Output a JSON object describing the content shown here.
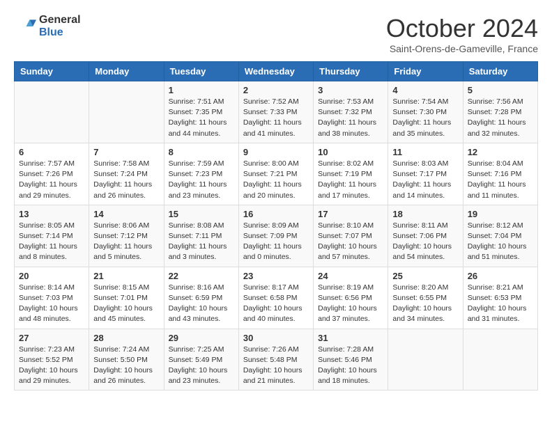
{
  "logo": {
    "general": "General",
    "blue": "Blue"
  },
  "header": {
    "month": "October 2024",
    "location": "Saint-Orens-de-Gameville, France"
  },
  "weekdays": [
    "Sunday",
    "Monday",
    "Tuesday",
    "Wednesday",
    "Thursday",
    "Friday",
    "Saturday"
  ],
  "weeks": [
    [
      {
        "day": "",
        "info": ""
      },
      {
        "day": "",
        "info": ""
      },
      {
        "day": "1",
        "info": "Sunrise: 7:51 AM\nSunset: 7:35 PM\nDaylight: 11 hours and 44 minutes."
      },
      {
        "day": "2",
        "info": "Sunrise: 7:52 AM\nSunset: 7:33 PM\nDaylight: 11 hours and 41 minutes."
      },
      {
        "day": "3",
        "info": "Sunrise: 7:53 AM\nSunset: 7:32 PM\nDaylight: 11 hours and 38 minutes."
      },
      {
        "day": "4",
        "info": "Sunrise: 7:54 AM\nSunset: 7:30 PM\nDaylight: 11 hours and 35 minutes."
      },
      {
        "day": "5",
        "info": "Sunrise: 7:56 AM\nSunset: 7:28 PM\nDaylight: 11 hours and 32 minutes."
      }
    ],
    [
      {
        "day": "6",
        "info": "Sunrise: 7:57 AM\nSunset: 7:26 PM\nDaylight: 11 hours and 29 minutes."
      },
      {
        "day": "7",
        "info": "Sunrise: 7:58 AM\nSunset: 7:24 PM\nDaylight: 11 hours and 26 minutes."
      },
      {
        "day": "8",
        "info": "Sunrise: 7:59 AM\nSunset: 7:23 PM\nDaylight: 11 hours and 23 minutes."
      },
      {
        "day": "9",
        "info": "Sunrise: 8:00 AM\nSunset: 7:21 PM\nDaylight: 11 hours and 20 minutes."
      },
      {
        "day": "10",
        "info": "Sunrise: 8:02 AM\nSunset: 7:19 PM\nDaylight: 11 hours and 17 minutes."
      },
      {
        "day": "11",
        "info": "Sunrise: 8:03 AM\nSunset: 7:17 PM\nDaylight: 11 hours and 14 minutes."
      },
      {
        "day": "12",
        "info": "Sunrise: 8:04 AM\nSunset: 7:16 PM\nDaylight: 11 hours and 11 minutes."
      }
    ],
    [
      {
        "day": "13",
        "info": "Sunrise: 8:05 AM\nSunset: 7:14 PM\nDaylight: 11 hours and 8 minutes."
      },
      {
        "day": "14",
        "info": "Sunrise: 8:06 AM\nSunset: 7:12 PM\nDaylight: 11 hours and 5 minutes."
      },
      {
        "day": "15",
        "info": "Sunrise: 8:08 AM\nSunset: 7:11 PM\nDaylight: 11 hours and 3 minutes."
      },
      {
        "day": "16",
        "info": "Sunrise: 8:09 AM\nSunset: 7:09 PM\nDaylight: 11 hours and 0 minutes."
      },
      {
        "day": "17",
        "info": "Sunrise: 8:10 AM\nSunset: 7:07 PM\nDaylight: 10 hours and 57 minutes."
      },
      {
        "day": "18",
        "info": "Sunrise: 8:11 AM\nSunset: 7:06 PM\nDaylight: 10 hours and 54 minutes."
      },
      {
        "day": "19",
        "info": "Sunrise: 8:12 AM\nSunset: 7:04 PM\nDaylight: 10 hours and 51 minutes."
      }
    ],
    [
      {
        "day": "20",
        "info": "Sunrise: 8:14 AM\nSunset: 7:03 PM\nDaylight: 10 hours and 48 minutes."
      },
      {
        "day": "21",
        "info": "Sunrise: 8:15 AM\nSunset: 7:01 PM\nDaylight: 10 hours and 45 minutes."
      },
      {
        "day": "22",
        "info": "Sunrise: 8:16 AM\nSunset: 6:59 PM\nDaylight: 10 hours and 43 minutes."
      },
      {
        "day": "23",
        "info": "Sunrise: 8:17 AM\nSunset: 6:58 PM\nDaylight: 10 hours and 40 minutes."
      },
      {
        "day": "24",
        "info": "Sunrise: 8:19 AM\nSunset: 6:56 PM\nDaylight: 10 hours and 37 minutes."
      },
      {
        "day": "25",
        "info": "Sunrise: 8:20 AM\nSunset: 6:55 PM\nDaylight: 10 hours and 34 minutes."
      },
      {
        "day": "26",
        "info": "Sunrise: 8:21 AM\nSunset: 6:53 PM\nDaylight: 10 hours and 31 minutes."
      }
    ],
    [
      {
        "day": "27",
        "info": "Sunrise: 7:23 AM\nSunset: 5:52 PM\nDaylight: 10 hours and 29 minutes."
      },
      {
        "day": "28",
        "info": "Sunrise: 7:24 AM\nSunset: 5:50 PM\nDaylight: 10 hours and 26 minutes."
      },
      {
        "day": "29",
        "info": "Sunrise: 7:25 AM\nSunset: 5:49 PM\nDaylight: 10 hours and 23 minutes."
      },
      {
        "day": "30",
        "info": "Sunrise: 7:26 AM\nSunset: 5:48 PM\nDaylight: 10 hours and 21 minutes."
      },
      {
        "day": "31",
        "info": "Sunrise: 7:28 AM\nSunset: 5:46 PM\nDaylight: 10 hours and 18 minutes."
      },
      {
        "day": "",
        "info": ""
      },
      {
        "day": "",
        "info": ""
      }
    ]
  ]
}
